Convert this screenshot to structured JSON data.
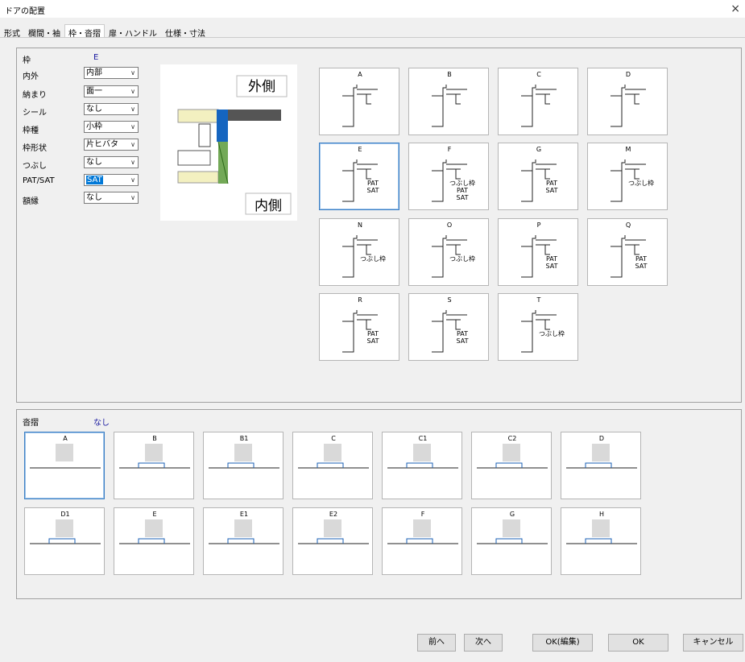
{
  "window": {
    "title": "ドアの配置",
    "close": "×"
  },
  "tabs": [
    "形式",
    "欄間・袖",
    "枠・沓摺",
    "扉・ハンドル",
    "仕様・寸法"
  ],
  "frame": {
    "header_label": "枠",
    "selected_value": "E",
    "fields": [
      {
        "label": "内外",
        "value": "内部"
      },
      {
        "label": "納まり",
        "value": "面一"
      },
      {
        "label": "シール",
        "value": "なし"
      },
      {
        "label": "枠種",
        "value": "小枠"
      },
      {
        "label": "枠形状",
        "value": "片ヒバタ"
      },
      {
        "label": "つぶし",
        "value": "なし"
      },
      {
        "label": "PAT/SAT",
        "value": "SAT"
      },
      {
        "label": "額縁",
        "value": "なし"
      }
    ],
    "preview": {
      "outside": "外側",
      "inside": "内側"
    },
    "tiles": [
      {
        "label": "A",
        "text": ""
      },
      {
        "label": "B",
        "text": ""
      },
      {
        "label": "C",
        "text": ""
      },
      {
        "label": "D",
        "text": ""
      },
      {
        "label": "E",
        "text": "PAT\nSAT"
      },
      {
        "label": "F",
        "text": "つぶし枠\nPAT\nSAT"
      },
      {
        "label": "G",
        "text": "PAT\nSAT"
      },
      {
        "label": "M",
        "text": "つぶし枠"
      },
      {
        "label": "N",
        "text": "つぶし枠"
      },
      {
        "label": "O",
        "text": "つぶし枠"
      },
      {
        "label": "P",
        "text": "PAT\nSAT"
      },
      {
        "label": "Q",
        "text": "PAT\nSAT"
      },
      {
        "label": "R",
        "text": "PAT\nSAT"
      },
      {
        "label": "S",
        "text": "PAT\nSAT"
      },
      {
        "label": "T",
        "text": "つぶし枠"
      }
    ]
  },
  "sill": {
    "header_label": "沓摺",
    "selected_value": "なし",
    "tiles": [
      "A",
      "B",
      "B1",
      "C",
      "C1",
      "C2",
      "D",
      "D1",
      "E",
      "E1",
      "E2",
      "F",
      "G",
      "H"
    ]
  },
  "buttons": {
    "prev": "前へ",
    "next": "次へ",
    "ok_edit": "OK(編集)",
    "ok": "OK",
    "cancel": "キャンセル"
  },
  "colors": {
    "selection": "#0078d7",
    "accent_blue": "#1a5fb4",
    "frame_blue": "#0b61c9"
  }
}
